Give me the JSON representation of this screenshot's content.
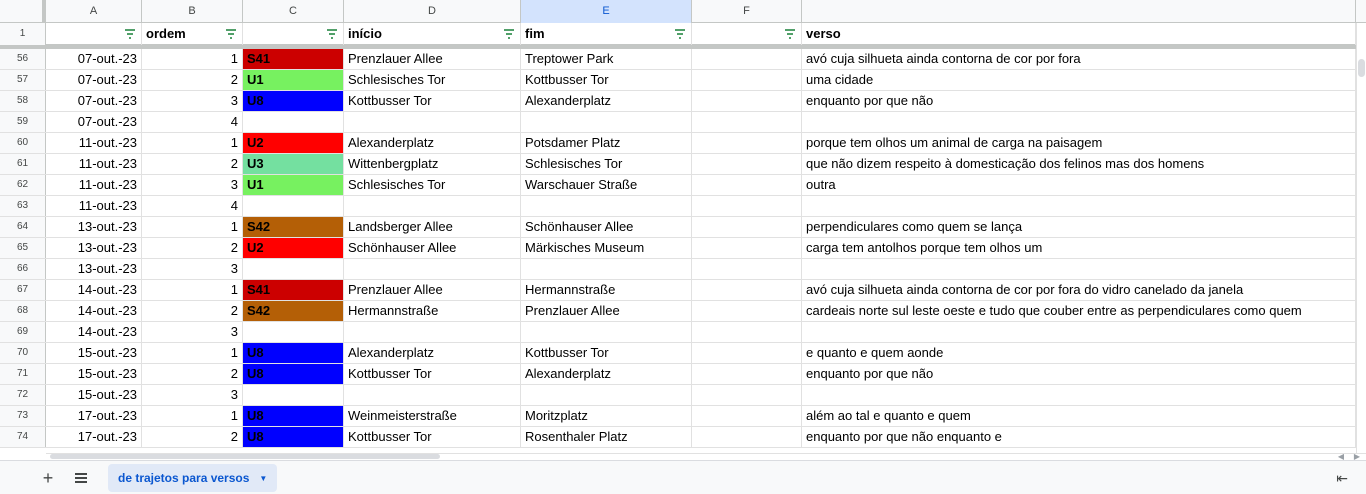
{
  "columns": [
    "A",
    "B",
    "C",
    "D",
    "E",
    "F"
  ],
  "header_row": {
    "number": "1",
    "cells": [
      "",
      "ordem",
      "",
      "início",
      "fim",
      "",
      "verso"
    ]
  },
  "colors": {
    "S41": "#cc0000",
    "U1": "#77f160",
    "U8": "#0000ff",
    "U2": "#ff0000",
    "U3": "#74e0a0",
    "S42": "#b45f06"
  },
  "rows": [
    {
      "n": "56",
      "date": "07-out.-23",
      "ordem": "1",
      "linha": "S41",
      "inicio": "Prenzlauer Allee",
      "fim": "Treptower Park",
      "verso": "avó cuja silhueta ainda contorna de cor por fora"
    },
    {
      "n": "57",
      "date": "07-out.-23",
      "ordem": "2",
      "linha": "U1",
      "inicio": "Schlesisches Tor",
      "fim": "Kottbusser Tor",
      "verso": "uma cidade"
    },
    {
      "n": "58",
      "date": "07-out.-23",
      "ordem": "3",
      "linha": "U8",
      "inicio": "Kottbusser Tor",
      "fim": "Alexanderplatz",
      "verso": "enquanto por que não"
    },
    {
      "n": "59",
      "date": "07-out.-23",
      "ordem": "4",
      "linha": "",
      "inicio": "",
      "fim": "",
      "verso": ""
    },
    {
      "n": "60",
      "date": "11-out.-23",
      "ordem": "1",
      "linha": "U2",
      "inicio": "Alexanderplatz",
      "fim": "Potsdamer Platz",
      "verso": "porque tem olhos um animal de carga na paisagem"
    },
    {
      "n": "61",
      "date": "11-out.-23",
      "ordem": "2",
      "linha": "U3",
      "inicio": "Wittenbergplatz",
      "fim": "Schlesisches Tor",
      "verso": "que não dizem respeito à domesticação dos felinos mas dos homens"
    },
    {
      "n": "62",
      "date": "11-out.-23",
      "ordem": "3",
      "linha": "U1",
      "inicio": "Schlesisches Tor",
      "fim": "Warschauer Straße",
      "verso": "outra"
    },
    {
      "n": "63",
      "date": "11-out.-23",
      "ordem": "4",
      "linha": "",
      "inicio": "",
      "fim": "",
      "verso": ""
    },
    {
      "n": "64",
      "date": "13-out.-23",
      "ordem": "1",
      "linha": "S42",
      "inicio": "Landsberger Allee",
      "fim": "Schönhauser Allee",
      "verso": "perpendiculares como quem se lança"
    },
    {
      "n": "65",
      "date": "13-out.-23",
      "ordem": "2",
      "linha": "U2",
      "inicio": "Schönhauser Allee",
      "fim": "Märkisches Museum",
      "verso": "carga tem antolhos porque tem olhos um"
    },
    {
      "n": "66",
      "date": "13-out.-23",
      "ordem": "3",
      "linha": "",
      "inicio": "",
      "fim": "",
      "verso": ""
    },
    {
      "n": "67",
      "date": "14-out.-23",
      "ordem": "1",
      "linha": "S41",
      "inicio": "Prenzlauer Allee",
      "fim": "Hermannstraße",
      "verso": "avó cuja silhueta ainda contorna de cor por fora do vidro canelado da janela"
    },
    {
      "n": "68",
      "date": "14-out.-23",
      "ordem": "2",
      "linha": "S42",
      "inicio": "Hermannstraße",
      "fim": "Prenzlauer Allee",
      "verso": "cardeais norte sul leste oeste e tudo que couber entre as perpendiculares como quem"
    },
    {
      "n": "69",
      "date": "14-out.-23",
      "ordem": "3",
      "linha": "",
      "inicio": "",
      "fim": "",
      "verso": ""
    },
    {
      "n": "70",
      "date": "15-out.-23",
      "ordem": "1",
      "linha": "U8",
      "inicio": "Alexanderplatz",
      "fim": "Kottbusser Tor",
      "verso": "e quanto e quem aonde"
    },
    {
      "n": "71",
      "date": "15-out.-23",
      "ordem": "2",
      "linha": "U8",
      "inicio": "Kottbusser Tor",
      "fim": "Alexanderplatz",
      "verso": "enquanto por que não"
    },
    {
      "n": "72",
      "date": "15-out.-23",
      "ordem": "3",
      "linha": "",
      "inicio": "",
      "fim": "",
      "verso": ""
    },
    {
      "n": "73",
      "date": "17-out.-23",
      "ordem": "1",
      "linha": "U8",
      "inicio": "Weinmeisterstraße",
      "fim": "Moritzplatz",
      "verso": "além ao tal e quanto e quem"
    },
    {
      "n": "74",
      "date": "17-out.-23",
      "ordem": "2",
      "linha": "U8",
      "inicio": "Kottbusser Tor",
      "fim": "Rosenthaler Platz",
      "verso": "enquanto por que não enquanto e"
    }
  ],
  "sheet_tab": {
    "label": "de trajetos para versos"
  },
  "icons": {
    "add": "plus-icon",
    "list": "list-icon",
    "filter": "filter-icon",
    "explore": "collapse-icon"
  }
}
